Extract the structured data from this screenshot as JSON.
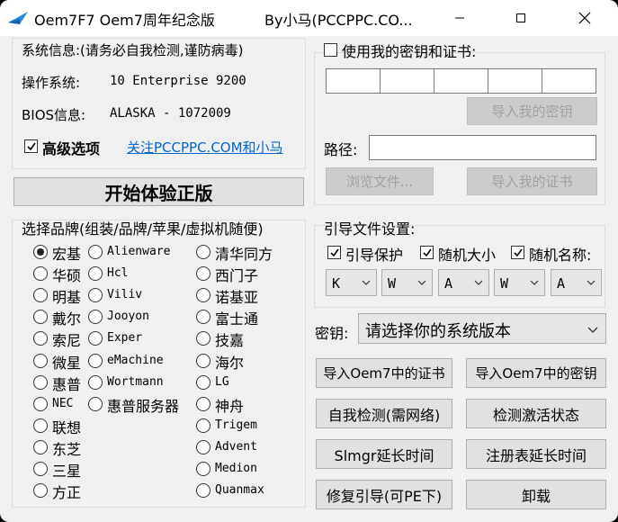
{
  "window": {
    "title": "Oem7F7 Oem7周年纪念版",
    "author": "By小马(PCCPPC.CO..."
  },
  "sysinfo": {
    "heading": "系统信息:(请务必自我检测,谨防病毒)",
    "os_label": "操作系统:",
    "os_value": "10 Enterprise 9200",
    "bios_label": "BIOS信息:",
    "bios_value": "ALASKA - 1072009",
    "advanced_label": "高级选项",
    "follow_link": "关注PCCPPC.COM和小马"
  },
  "start_button": "开始体验正版",
  "brand": {
    "heading": "选择品牌(组装/品牌/苹果/虚拟机随便)",
    "col1": [
      "宏基",
      "华硕",
      "明基",
      "戴尔",
      "索尼",
      "微星",
      "惠普",
      "NEC",
      "联想",
      "东芝",
      "三星",
      "方正"
    ],
    "col2": [
      "Alienware",
      "Hcl",
      "Viliv",
      "Jooyon",
      "Exper",
      "eMachine",
      "Wortmann",
      "惠普服务器"
    ],
    "col3": [
      "清华同方",
      "西门子",
      "诺基亚",
      "富士通",
      "技嘉",
      "海尔",
      "LG",
      "神舟",
      "Trigem",
      "Advent",
      "Medion",
      "Quanmax"
    ],
    "selected": "宏基"
  },
  "keycert": {
    "use_own_label": "使用我的密钥和证书:",
    "import_key": "导入我的密钥",
    "path_label": "路径:",
    "browse": "浏览文件...",
    "import_cert": "导入我的证书"
  },
  "bootfile": {
    "heading": "引导文件设置:",
    "protect": "引导保护",
    "random_size": "随机大小",
    "random_name": "随机名称:",
    "combos": [
      "K",
      "W",
      "A",
      "W",
      "A"
    ]
  },
  "key": {
    "label": "密钥:",
    "selected": "请选择你的系统版本"
  },
  "actions": {
    "import_cert": "导入Oem7中的证书",
    "import_key": "导入Oem7中的密钥",
    "self_check": "自我检测(需网络)",
    "check_activation": "检测激活状态",
    "slmgr": "Slmgr延长时间",
    "registry": "注册表延长时间",
    "repair_boot": "修复引导(可PE下)",
    "uninstall": "卸载"
  }
}
